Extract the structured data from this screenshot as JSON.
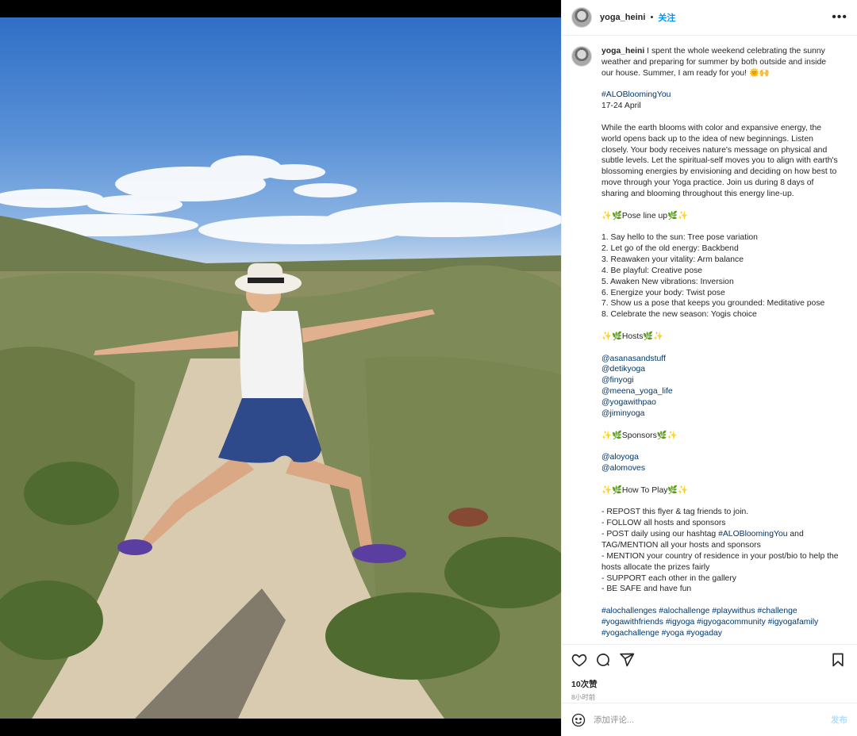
{
  "post": {
    "username": "yoga_heini",
    "separator": "•",
    "follow_label": "关注",
    "more_label": "•••",
    "photo_alt": "yoga-warrior-pose-photo"
  },
  "caption": {
    "username": "yoga_heini",
    "intro": " I spent the whole weekend celebrating the sunny weather and preparing for summer by both outside and inside our house. Summer, I am ready for you! 🌞🙌",
    "hashtag_main": "#ALOBloomingYou",
    "dates": "17-24 April",
    "body": "While the earth blooms with color and expansive energy, the world opens back up to the idea of new beginnings. Listen closely. Your body receives nature's message on physical and subtle levels. Let the spiritual-self moves you to align with earth's blossoming energies by envisioning and deciding on how best to move through your Yoga practice. Join us during 8 days of sharing and blooming throughout this energy line-up.",
    "pose_heading": "✨🌿Pose line up🌿✨",
    "poses": [
      "1. Say hello to the sun: Tree pose variation",
      "2. Let go of the old energy: Backbend",
      "3. Reawaken your vitality: Arm balance",
      "4. Be playful: Creative pose",
      "5. Awaken New vibrations: Inversion",
      "6. Energize your body: Twist pose",
      "7. Show us a pose that keeps you grounded: Meditative pose",
      "8. Celebrate the new season: Yogis choice"
    ],
    "hosts_heading": "✨🌿Hosts🌿✨",
    "hosts": [
      "@asanasandstuff",
      "@detikyoga",
      "@finyogi",
      "@meena_yoga_life",
      "@yogawithpao",
      "@jiminyoga"
    ],
    "sponsors_heading": "✨🌿Sponsors🌿✨",
    "sponsors": [
      "@aloyoga",
      "@alomoves"
    ],
    "howto_heading": "✨🌿How To Play🌿✨",
    "rules": {
      "r1": "- REPOST this flyer & tag friends to join.",
      "r2": "- FOLLOW all hosts and sponsors",
      "r3a": "- POST daily using our hashtag ",
      "r3tag": "#ALOBloomingYou",
      "r3b": " and TAG/MENTION all your hosts and sponsors",
      "r4": "- MENTION your country of residence in your post/bio to help the hosts allocate the prizes fairly",
      "r5": "- SUPPORT each other in the gallery",
      "r6": "- BE SAFE and have fun"
    },
    "hashtags_line1": "#alochallenges #alochallenge #playwithus #challenge",
    "hashtags_line2": "#yogawithfriends #igyoga #igyogacommunity #igyogafamily",
    "hashtags_line3": "#yogachallenge #yoga #yogaday"
  },
  "stats": {
    "likes": "10次赞",
    "time": "8小时前"
  },
  "comment": {
    "placeholder": "添加评论...",
    "post_label": "发布"
  },
  "icons": [
    "heart-icon",
    "comment-icon",
    "share-icon",
    "bookmark-icon",
    "emoji-icon",
    "more-icon"
  ],
  "colors": {
    "link": "#00376b",
    "follow": "#0095f6",
    "post_disabled": "#b2dffc",
    "muted": "#8e8e8e"
  }
}
